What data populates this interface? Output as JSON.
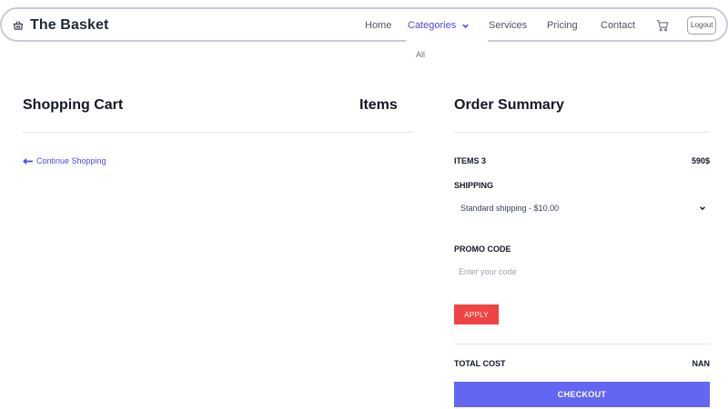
{
  "navbar": {
    "brand": "The Basket",
    "brand_icon": "basket-icon",
    "links": {
      "home": "Home",
      "categories": "Categories",
      "services": "Services",
      "pricing": "Pricing",
      "contact": "Contact"
    },
    "cart_icon": "cart-icon",
    "logout": "Logout",
    "accent_color": "#4f46e5"
  },
  "categories_dropdown": {
    "items": [
      "All"
    ]
  },
  "cart": {
    "title": "Shopping Cart",
    "items_heading": "Items",
    "continue_shopping": "Continue Shopping"
  },
  "summary": {
    "title": "Order Summary",
    "items_label": "ITEMS 3",
    "items_total": "590$",
    "shipping_label": "SHIPPING",
    "shipping_selected": "Standard shipping - $10.00",
    "promo_label": "PROMO CODE",
    "promo_placeholder": "Enter your code",
    "apply": "APPLY",
    "total_label": "TOTAL COST",
    "total_value": "NAN",
    "checkout": "CHECKOUT",
    "apply_color": "#ef4444",
    "checkout_color": "#6366f1"
  }
}
